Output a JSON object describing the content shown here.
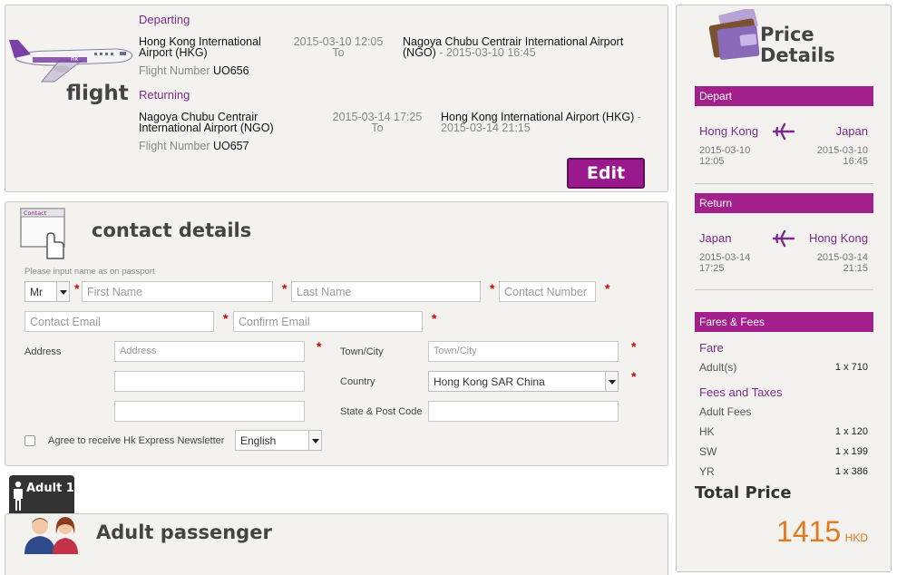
{
  "flight": {
    "section_word": "flight",
    "departing": {
      "label": "Departing",
      "from_airport": "Hong Kong International Airport (HKG)",
      "datetime": "2015-03-10 12:05",
      "to_word": "To",
      "to_airport": "Nagoya Chubu Centrair International Airport (NGO)",
      "arrival": "- 2015-03-10 16:45",
      "flight_number_label": "Flight Number",
      "flight_number": "UO656"
    },
    "returning": {
      "label": "Returning",
      "from_airport": "Nagoya Chubu Centrair International Airport (NGO)",
      "datetime": "2015-03-14 17:25",
      "to_word": "To",
      "to_airport": "Hong Kong International Airport (HKG)",
      "arrival": "- 2015-03-14 21:15",
      "flight_number_label": "Flight Number",
      "flight_number": "UO657"
    },
    "edit_label": "Edit",
    "plane_logo_text": "hkexpress"
  },
  "contact": {
    "title": "contact details",
    "icon_text": "Contact",
    "hint": "Please input name as on passport",
    "title_select": "Mr",
    "first_name_ph": "First Name",
    "last_name_ph": "Last Name",
    "contact_number_ph": "Contact Number",
    "contact_email_ph": "Contact Email",
    "confirm_email_ph": "Confirm Email",
    "address_label": "Address",
    "address_ph": "Address",
    "town_label": "Town/City",
    "town_ph": "Town/City",
    "country_label": "Country",
    "country_value": "Hong Kong SAR China",
    "state_label": "State & Post Code",
    "newsletter_label": "Agree to receive Hk Express Newsletter",
    "language_value": "English",
    "required_mark": "*"
  },
  "adult": {
    "tab_label": "Adult 1",
    "title": "Adult passenger"
  },
  "price": {
    "title_line1": "Price",
    "title_line2": "Details",
    "depart": {
      "header": "Depart",
      "from": "Hong Kong",
      "to": "Japan",
      "from_date": "2015-03-10",
      "from_time": "12:05",
      "to_date": "2015-03-10",
      "to_time": "16:45"
    },
    "return": {
      "header": "Return",
      "from": "Japan",
      "to": "Hong Kong",
      "from_date": "2015-03-14",
      "from_time": "17:25",
      "to_date": "2015-03-14",
      "to_time": "21:15"
    },
    "fares_header": "Fares & Fees",
    "fare_label": "Fare",
    "adults_label": "Adult(s)",
    "adults_value": "1 x 710",
    "fees_label": "Fees and Taxes",
    "adult_fees_label": "Adult Fees",
    "fees": [
      {
        "code": "HK",
        "value": "1 x 120"
      },
      {
        "code": "SW",
        "value": "1 x 199"
      },
      {
        "code": "YR",
        "value": "1 x 386"
      }
    ],
    "total_label": "Total Price",
    "total_amount": "1415",
    "currency": "HKD"
  },
  "colors": {
    "accent": "#a3208c",
    "total": "#e07a1f"
  }
}
